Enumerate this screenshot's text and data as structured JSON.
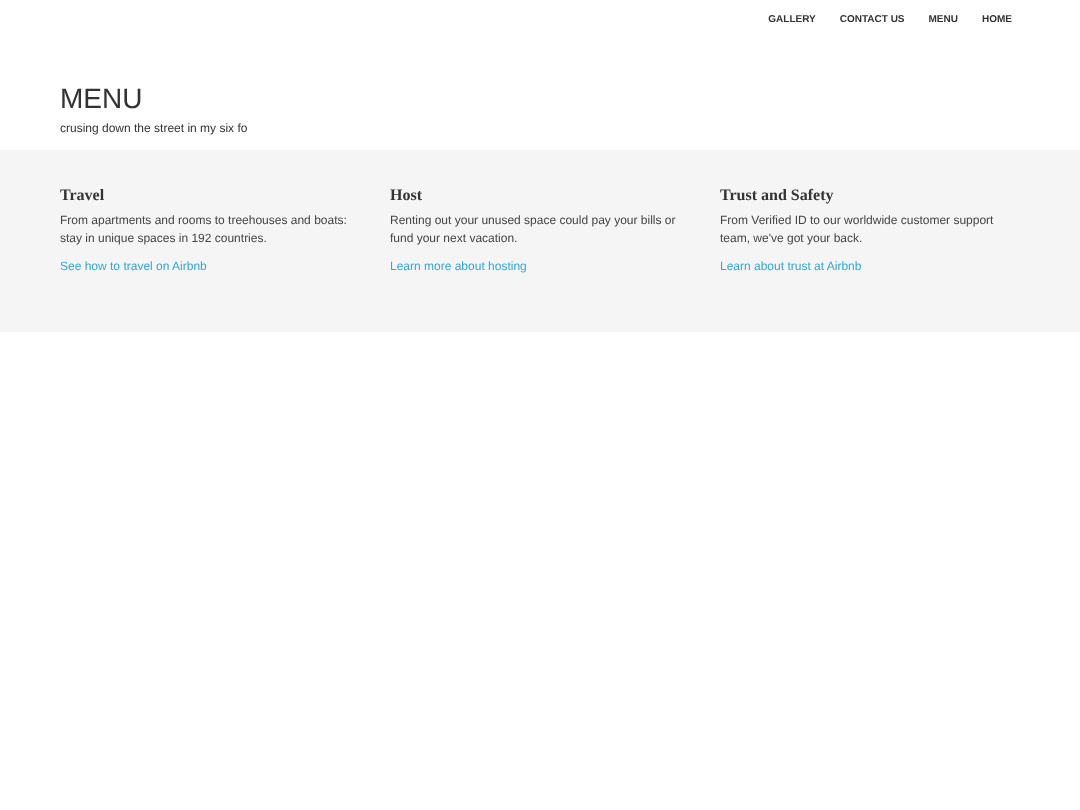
{
  "nav": [
    "GALLERY",
    "CONTACT US",
    "MENU",
    "HOME"
  ],
  "header": {
    "title": "MENU",
    "subtitle": "crusing down the street in my six fo"
  },
  "features": [
    {
      "title": "Travel",
      "text": "From apartments and rooms to treehouses and boats: stay in unique spaces in 192 countries.",
      "link": "See how to travel on Airbnb"
    },
    {
      "title": "Host",
      "text": "Renting out your unused space could pay your bills or fund your next vacation.",
      "link": "Learn more about hosting"
    },
    {
      "title": "Trust and Safety",
      "text": "From Verified ID to our worldwide customer support team, we've got your back.",
      "link": "Learn about trust at Airbnb"
    }
  ]
}
